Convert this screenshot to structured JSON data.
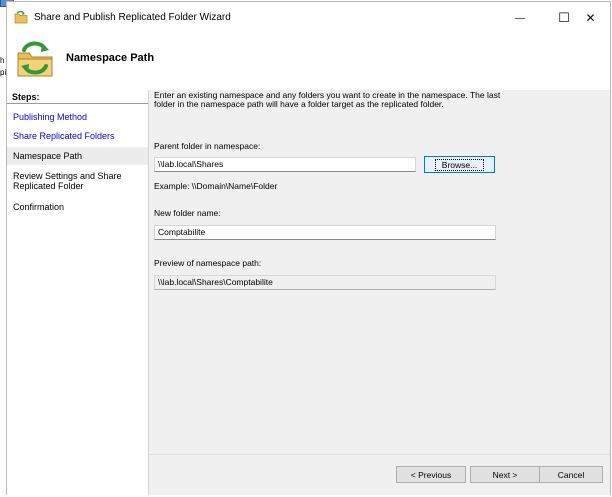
{
  "background": {
    "fragments": [
      "h",
      "pi"
    ]
  },
  "window": {
    "title": "Share and Publish Replicated Folder Wizard",
    "controls": {
      "minimize": "—",
      "maximize": "☐",
      "close": "✕"
    }
  },
  "header": {
    "title": "Namespace Path"
  },
  "sidebar": {
    "heading": "Steps:",
    "items": [
      {
        "label": "Publishing Method",
        "state": "link"
      },
      {
        "label": "Share Replicated Folders",
        "state": "link"
      },
      {
        "label": "Namespace Path",
        "state": "current"
      },
      {
        "label": "Review Settings and Share Replicated Folder",
        "state": "plain"
      },
      {
        "label": "Confirmation",
        "state": "plain"
      }
    ]
  },
  "main": {
    "intro": "Enter an existing namespace and any folders you want to create in the namespace. The last folder in the namespace path will have a folder target as the replicated folder.",
    "parent_label": "Parent folder in namespace:",
    "parent_value": "\\\\lab.local\\Shares",
    "browse_label": "Browse...",
    "example_text": "Example: \\\\Domain\\Name\\Folder",
    "new_folder_label": "New folder name:",
    "new_folder_value": "Comptabilite",
    "preview_label": "Preview of namespace path:",
    "preview_value": "\\\\lab.local\\Shares\\Comptabilite"
  },
  "footer": {
    "previous_label": "< Previous",
    "next_label": "Next >",
    "cancel_label": "Cancel"
  }
}
